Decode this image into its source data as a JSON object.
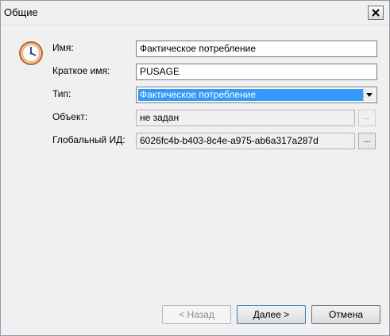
{
  "window": {
    "title": "Общие",
    "close_glyph": "×"
  },
  "icon": "clock-icon",
  "form": {
    "name_label": "Имя:",
    "name_value": "Фактическое потребление",
    "short_name_label": "Краткое имя:",
    "short_name_value": "PUSAGE",
    "type_label": "Тип:",
    "type_value": "Фактическое потребление",
    "object_label": "Объект:",
    "object_value": "не задан",
    "global_id_label": "Глобальный ИД:",
    "global_id_value": "6026fc4b-b403-8c4e-a975-ab6a317a287d",
    "browse_label": "..."
  },
  "footer": {
    "back_label": "< Назад",
    "next_label": "Далее >",
    "cancel_label": "Отмена"
  },
  "colors": {
    "selection": "#3399ff",
    "window_bg": "#f0f0f0"
  }
}
